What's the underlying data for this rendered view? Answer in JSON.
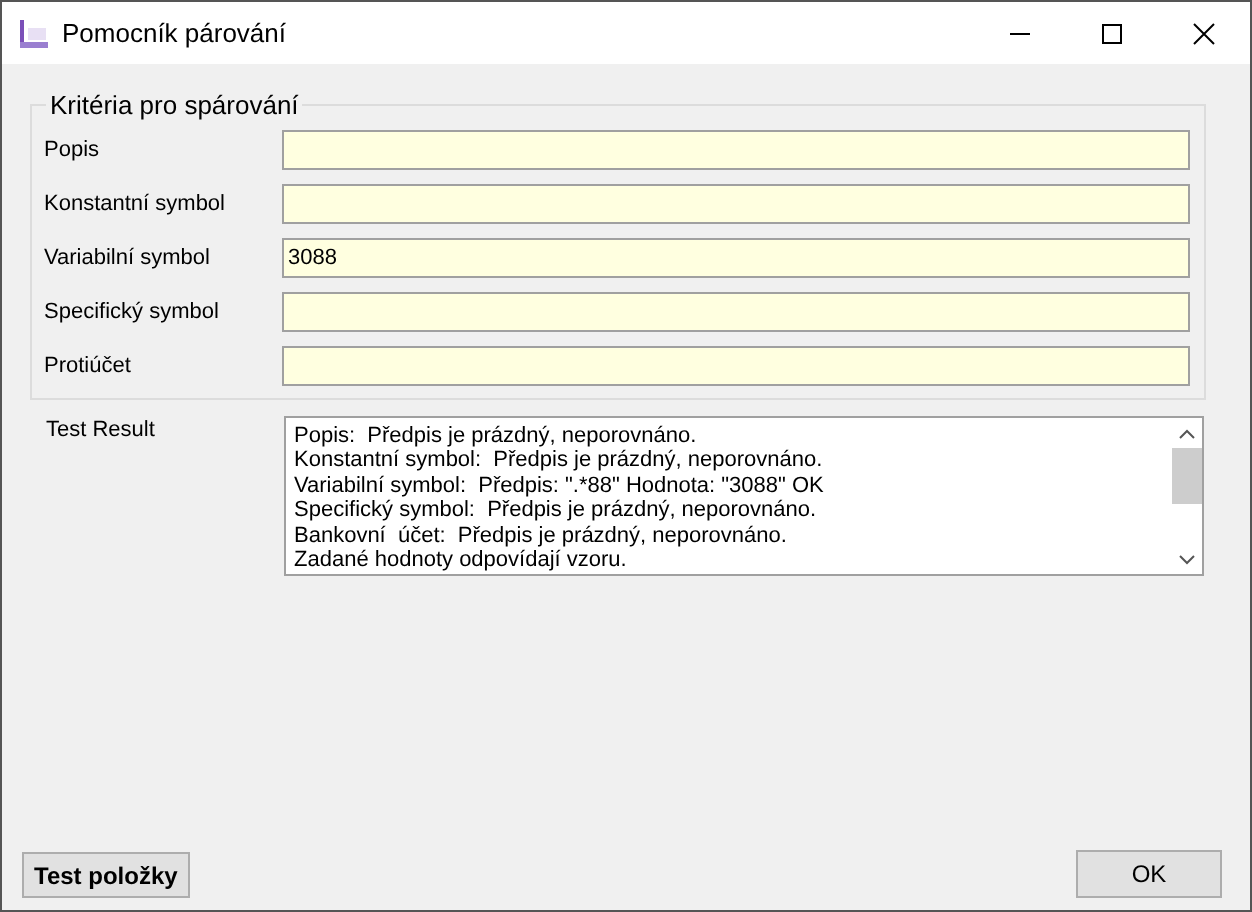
{
  "window": {
    "title": "Pomocník párování"
  },
  "criteria": {
    "title": "Kritéria pro spárování",
    "fields": [
      {
        "label": "Popis"
      },
      {
        "label": "Konstantní symbol"
      },
      {
        "label": "Variabilní symbol",
        "value": "3088"
      },
      {
        "label": "Specifický symbol"
      },
      {
        "label": "Protiúčet"
      }
    ]
  },
  "test_result": {
    "label": "Test Result",
    "lines": [
      "Popis:  Předpis je prázdný, neporovnáno.",
      "Konstantní symbol:  Předpis je prázdný, neporovnáno.",
      "Variabilní symbol:  Předpis: \".*88\" Hodnota: \"3088\" OK",
      "Specifický symbol:  Předpis je prázdný, neporovnáno.",
      "Bankovní  účet:  Předpis je prázdný, neporovnáno.",
      "Zadané hodnoty odpovídají vzoru."
    ]
  },
  "buttons": {
    "test": "Test položky",
    "ok": "OK"
  }
}
